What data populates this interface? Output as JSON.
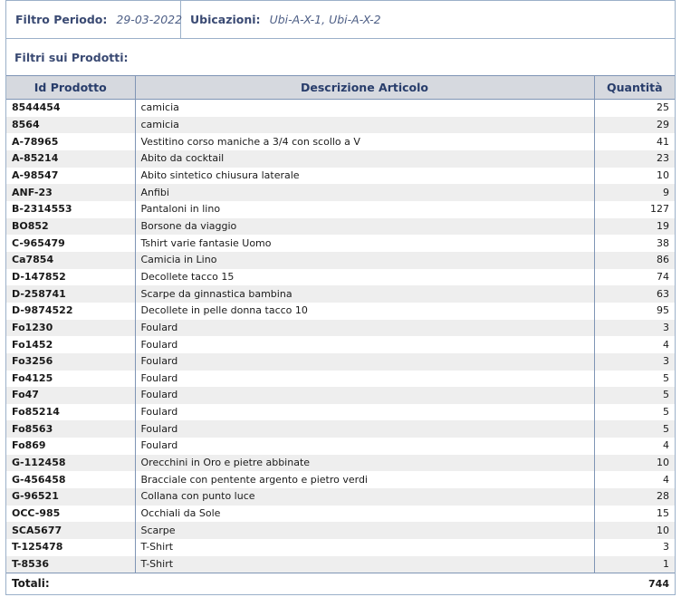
{
  "filters": {
    "period_label": "Filtro Periodo:",
    "period_value": "29-03-2022",
    "locations_label": "Ubicazioni:",
    "locations_value": "Ubi-A-X-1, Ubi-A-X-2",
    "products_label": "Filtri sui Prodotti:"
  },
  "table": {
    "headers": {
      "id": "Id Prodotto",
      "description": "Descrizione Articolo",
      "quantity": "Quantità"
    },
    "rows": [
      {
        "id": "8544454",
        "description": "camicia",
        "quantity": "25"
      },
      {
        "id": "8564",
        "description": "camicia",
        "quantity": "29"
      },
      {
        "id": "A-78965",
        "description": "Vestitino corso maniche a 3/4 con scollo a V",
        "quantity": "41"
      },
      {
        "id": "A-85214",
        "description": "Abito da cocktail",
        "quantity": "23"
      },
      {
        "id": "A-98547",
        "description": "Abito sintetico chiusura laterale",
        "quantity": "10"
      },
      {
        "id": "ANF-23",
        "description": "Anfibi",
        "quantity": "9"
      },
      {
        "id": "B-2314553",
        "description": "Pantaloni in lino",
        "quantity": "127"
      },
      {
        "id": "BO852",
        "description": "Borsone da viaggio",
        "quantity": "19"
      },
      {
        "id": "C-965479",
        "description": "Tshirt varie fantasie Uomo",
        "quantity": "38"
      },
      {
        "id": "Ca7854",
        "description": "Camicia in Lino",
        "quantity": "86"
      },
      {
        "id": "D-147852",
        "description": "Decollete tacco 15",
        "quantity": "74"
      },
      {
        "id": "D-258741",
        "description": "Scarpe da ginnastica bambina",
        "quantity": "63"
      },
      {
        "id": "D-9874522",
        "description": "Decollete in pelle donna tacco 10",
        "quantity": "95"
      },
      {
        "id": "Fo1230",
        "description": "Foulard",
        "quantity": "3"
      },
      {
        "id": "Fo1452",
        "description": "Foulard",
        "quantity": "4"
      },
      {
        "id": "Fo3256",
        "description": "Foulard",
        "quantity": "3"
      },
      {
        "id": "Fo4125",
        "description": "Foulard",
        "quantity": "5"
      },
      {
        "id": "Fo47",
        "description": "Foulard",
        "quantity": "5"
      },
      {
        "id": "Fo85214",
        "description": "Foulard",
        "quantity": "5"
      },
      {
        "id": "Fo8563",
        "description": "Foulard",
        "quantity": "5"
      },
      {
        "id": "Fo869",
        "description": "Foulard",
        "quantity": "4"
      },
      {
        "id": "G-112458",
        "description": "Orecchini in Oro e pietre abbinate",
        "quantity": "10"
      },
      {
        "id": "G-456458",
        "description": "Bracciale con pentente argento e pietro verdi",
        "quantity": "4"
      },
      {
        "id": "G-96521",
        "description": "Collana con punto luce",
        "quantity": "28"
      },
      {
        "id": "OCC-985",
        "description": "Occhiali da Sole",
        "quantity": "15"
      },
      {
        "id": "SCA5677",
        "description": "Scarpe",
        "quantity": "10"
      },
      {
        "id": "T-125478",
        "description": "T-Shirt",
        "quantity": "3"
      },
      {
        "id": "T-8536",
        "description": "T-Shirt",
        "quantity": "1"
      }
    ],
    "totals_label": "Totali:",
    "totals_value": "744"
  }
}
